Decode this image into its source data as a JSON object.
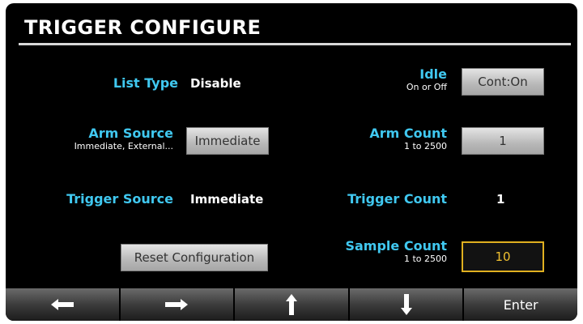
{
  "title": "TRIGGER CONFIGURE",
  "list_type": {
    "label": "List Type",
    "value": "Disable"
  },
  "idle": {
    "label": "Idle",
    "hint": "On or Off",
    "button": "Cont:On"
  },
  "arm_source": {
    "label": "Arm Source",
    "hint": "Immediate, External...",
    "button": "Immediate"
  },
  "arm_count": {
    "label": "Arm Count",
    "hint": "1 to 2500",
    "button": "1"
  },
  "trigger_source": {
    "label": "Trigger Source",
    "value": "Immediate"
  },
  "trigger_count": {
    "label": "Trigger Count",
    "value": "1"
  },
  "reset": {
    "button": "Reset Configuration"
  },
  "sample_count": {
    "label": "Sample Count",
    "hint": "1 to 2500",
    "button": "10"
  },
  "softkeys": {
    "left": "left-arrow-icon",
    "right": "right-arrow-icon",
    "up": "up-arrow-icon",
    "down": "down-arrow-icon",
    "enter": "Enter"
  },
  "colors": {
    "label": "#40c8f0",
    "active_border": "#e0b020",
    "active_text": "#f0c030"
  }
}
